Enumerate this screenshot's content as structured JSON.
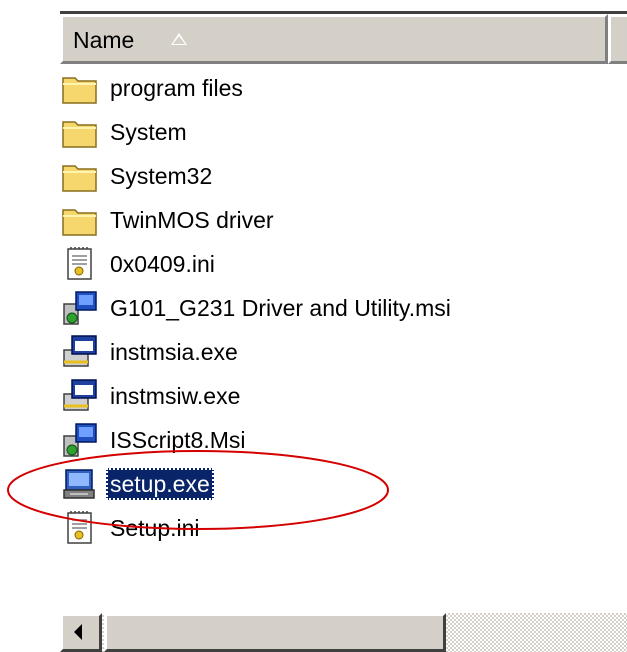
{
  "header": {
    "name_label": "Name"
  },
  "files": [
    {
      "label": "program files",
      "icon": "folder-icon",
      "selected": false
    },
    {
      "label": "System",
      "icon": "folder-icon",
      "selected": false
    },
    {
      "label": "System32",
      "icon": "folder-icon",
      "selected": false
    },
    {
      "label": "TwinMOS driver",
      "icon": "folder-icon",
      "selected": false
    },
    {
      "label": "0x0409.ini",
      "icon": "ini-file-icon",
      "selected": false
    },
    {
      "label": "G101_G231 Driver and Utility.msi",
      "icon": "msi-file-icon",
      "selected": false
    },
    {
      "label": "instmsia.exe",
      "icon": "installer-exe-icon",
      "selected": false
    },
    {
      "label": "instmsiw.exe",
      "icon": "installer-exe-icon",
      "selected": false
    },
    {
      "label": "ISScript8.Msi",
      "icon": "msi-file-icon",
      "selected": false
    },
    {
      "label": "setup.exe",
      "icon": "setup-exe-icon",
      "selected": true
    },
    {
      "label": "Setup.ini",
      "icon": "ini-file-icon",
      "selected": false
    }
  ],
  "colors": {
    "selection_bg": "#0a246a",
    "annotation": "#d40000",
    "folder": "#f5d76e",
    "chrome": "#d4d0c8"
  }
}
